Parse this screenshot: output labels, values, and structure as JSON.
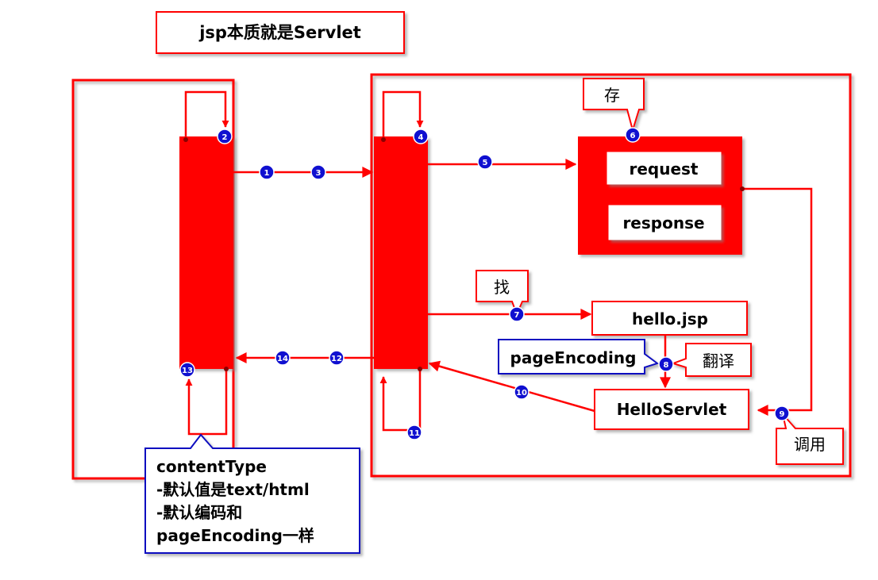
{
  "title": "jsp本质就是Servlet",
  "store_callout": "存",
  "find_callout": "找",
  "translate_callout": "翻译",
  "call_callout": "调用",
  "request_label": "request",
  "response_label": "response",
  "hello_jsp_label": "hello.jsp",
  "hello_servlet_label": "HelloServlet",
  "page_encoding_label": "pageEncoding",
  "content_type_note": [
    "contentType",
    "-默认值是text/html",
    "-默认编码和",
    "pageEncoding一样"
  ],
  "steps": [
    "1",
    "2",
    "3",
    "4",
    "5",
    "6",
    "7",
    "8",
    "9",
    "10",
    "11",
    "12",
    "13",
    "14"
  ],
  "colors": {
    "accent": "#ff0000",
    "note_border": "#1010c0",
    "badge": "#1010d0"
  }
}
